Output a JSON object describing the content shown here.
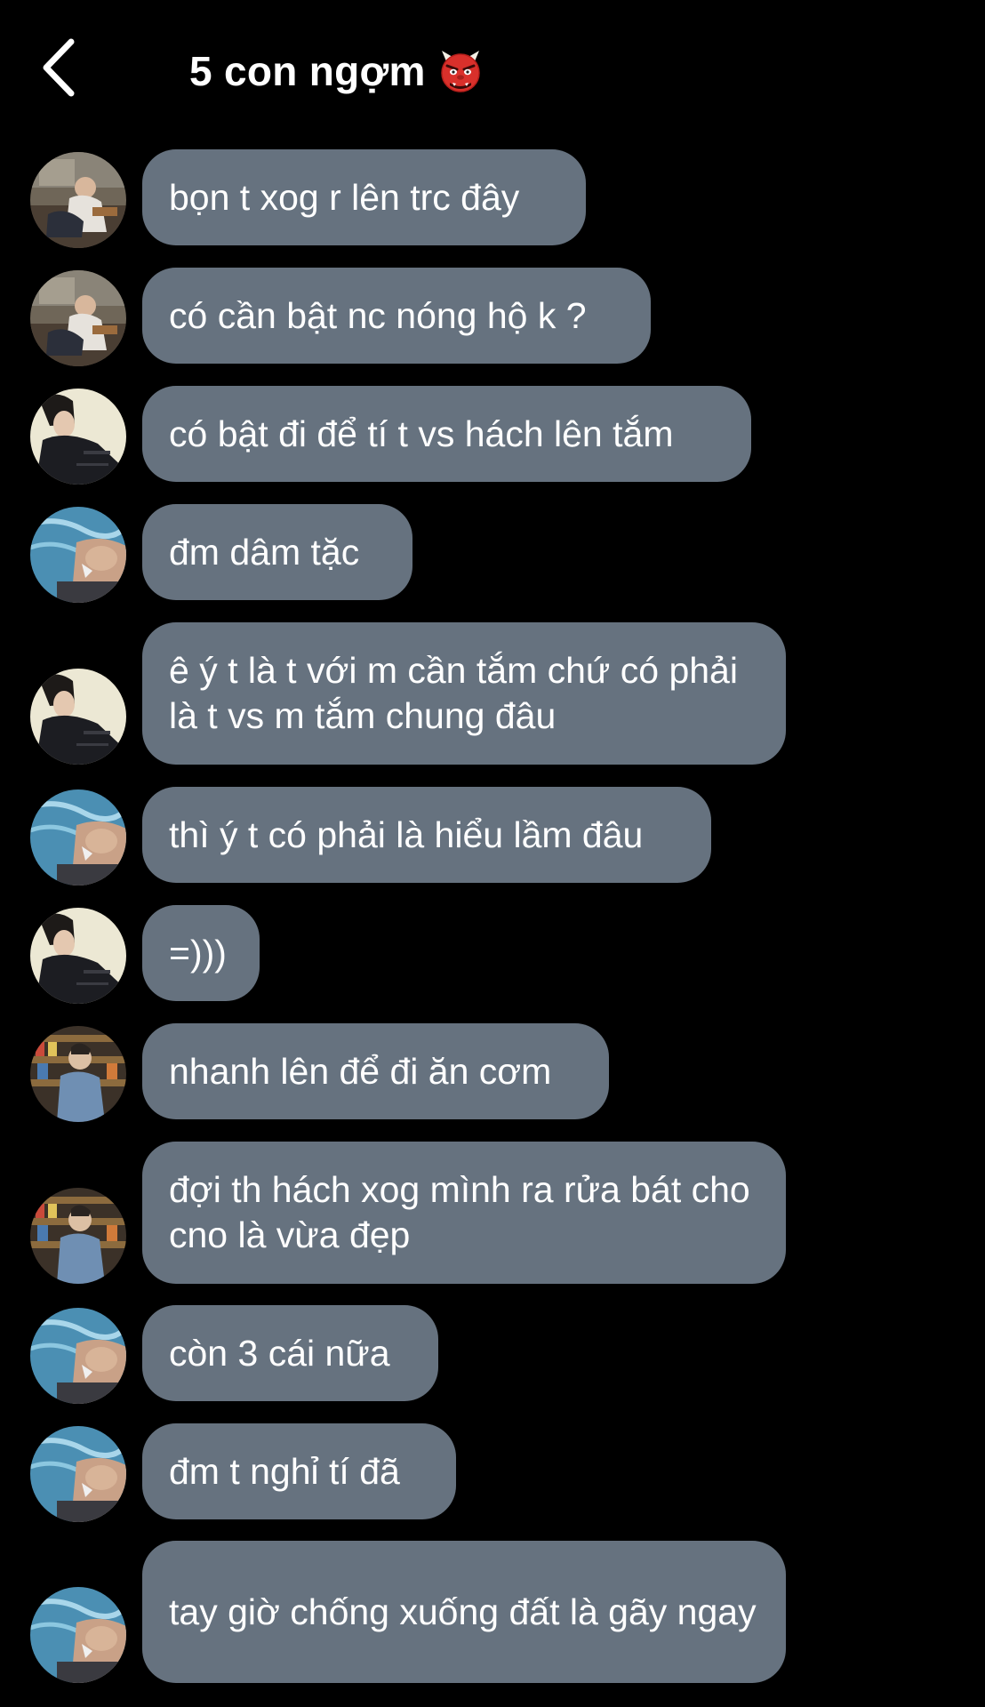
{
  "header": {
    "title": "5 con ngợm",
    "back_icon": "chevron-left-icon",
    "title_emoji": "ogre-emoji-icon"
  },
  "colors": {
    "background": "#000000",
    "bubble": "#66727f",
    "text": "#ffffff"
  },
  "messages": [
    {
      "sender": "avatar-room",
      "text": "bọn t xog r lên trc đây"
    },
    {
      "sender": "avatar-room",
      "text": "có cần bật nc nóng hộ k ?"
    },
    {
      "sender": "avatar-jacket",
      "text": "có bật đi để tí t vs hách lên tắm"
    },
    {
      "sender": "avatar-pool",
      "text": "đm dâm tặc"
    },
    {
      "sender": "avatar-jacket",
      "text": "ê ý t là t với m cần tắm chứ có phải là t vs m tắm chung đâu"
    },
    {
      "sender": "avatar-pool",
      "text": "thì ý t có phải là hiểu lầm đâu"
    },
    {
      "sender": "avatar-jacket",
      "text": "=)))"
    },
    {
      "sender": "avatar-store",
      "text": "nhanh lên để đi ăn cơm"
    },
    {
      "sender": "avatar-store",
      "text": "đợi th hách xog mình ra rửa bát cho cno là vừa đẹp"
    },
    {
      "sender": "avatar-pool",
      "text": "còn 3 cái nữa"
    },
    {
      "sender": "avatar-pool",
      "text": "đm t nghỉ tí đã"
    },
    {
      "sender": "avatar-pool",
      "text": "tay giờ chống xuống đất là gãy ngay"
    }
  ]
}
